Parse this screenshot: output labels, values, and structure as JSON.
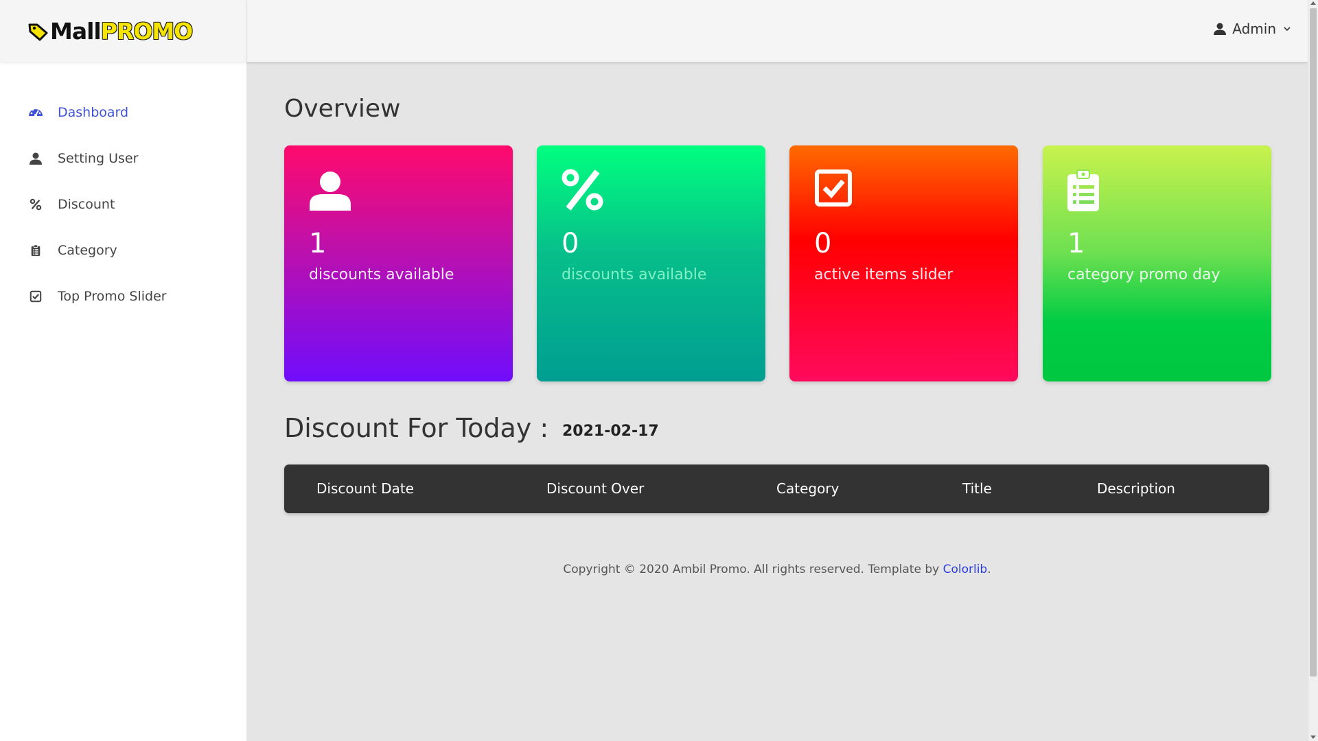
{
  "brand": {
    "part1": "Mall",
    "part2": "PROMO",
    "accent": "#f4e400"
  },
  "header": {
    "user_name": "Admin"
  },
  "sidebar": {
    "items": [
      {
        "label": "Dashboard",
        "icon": "dashboard-icon",
        "active": true
      },
      {
        "label": "Setting User",
        "icon": "user-icon"
      },
      {
        "label": "Discount",
        "icon": "percent-icon"
      },
      {
        "label": "Category",
        "icon": "clipboard-list-icon"
      },
      {
        "label": "Top Promo Slider",
        "icon": "check-square-icon"
      }
    ],
    "active_color": "#3f51d6"
  },
  "main": {
    "title": "Overview",
    "cards": [
      {
        "value": "1",
        "label": "discounts available",
        "icon": "user-icon"
      },
      {
        "value": "0",
        "label": "discounts available",
        "icon": "percent-icon"
      },
      {
        "value": "0",
        "label": "active items slider",
        "icon": "check-square-icon"
      },
      {
        "value": "1",
        "label": "category promo day",
        "icon": "clipboard-list-icon"
      }
    ],
    "today_label": "Discount For Today :",
    "today_date": "2021-02-17",
    "table": {
      "headers": [
        "Discount Date",
        "Discount Over",
        "Category",
        "Title",
        "Description"
      ],
      "rows": []
    }
  },
  "footer": {
    "text": "Copyright © 2020 Ambil Promo. All rights reserved. Template by ",
    "link": "Colorlib",
    "end": "."
  }
}
